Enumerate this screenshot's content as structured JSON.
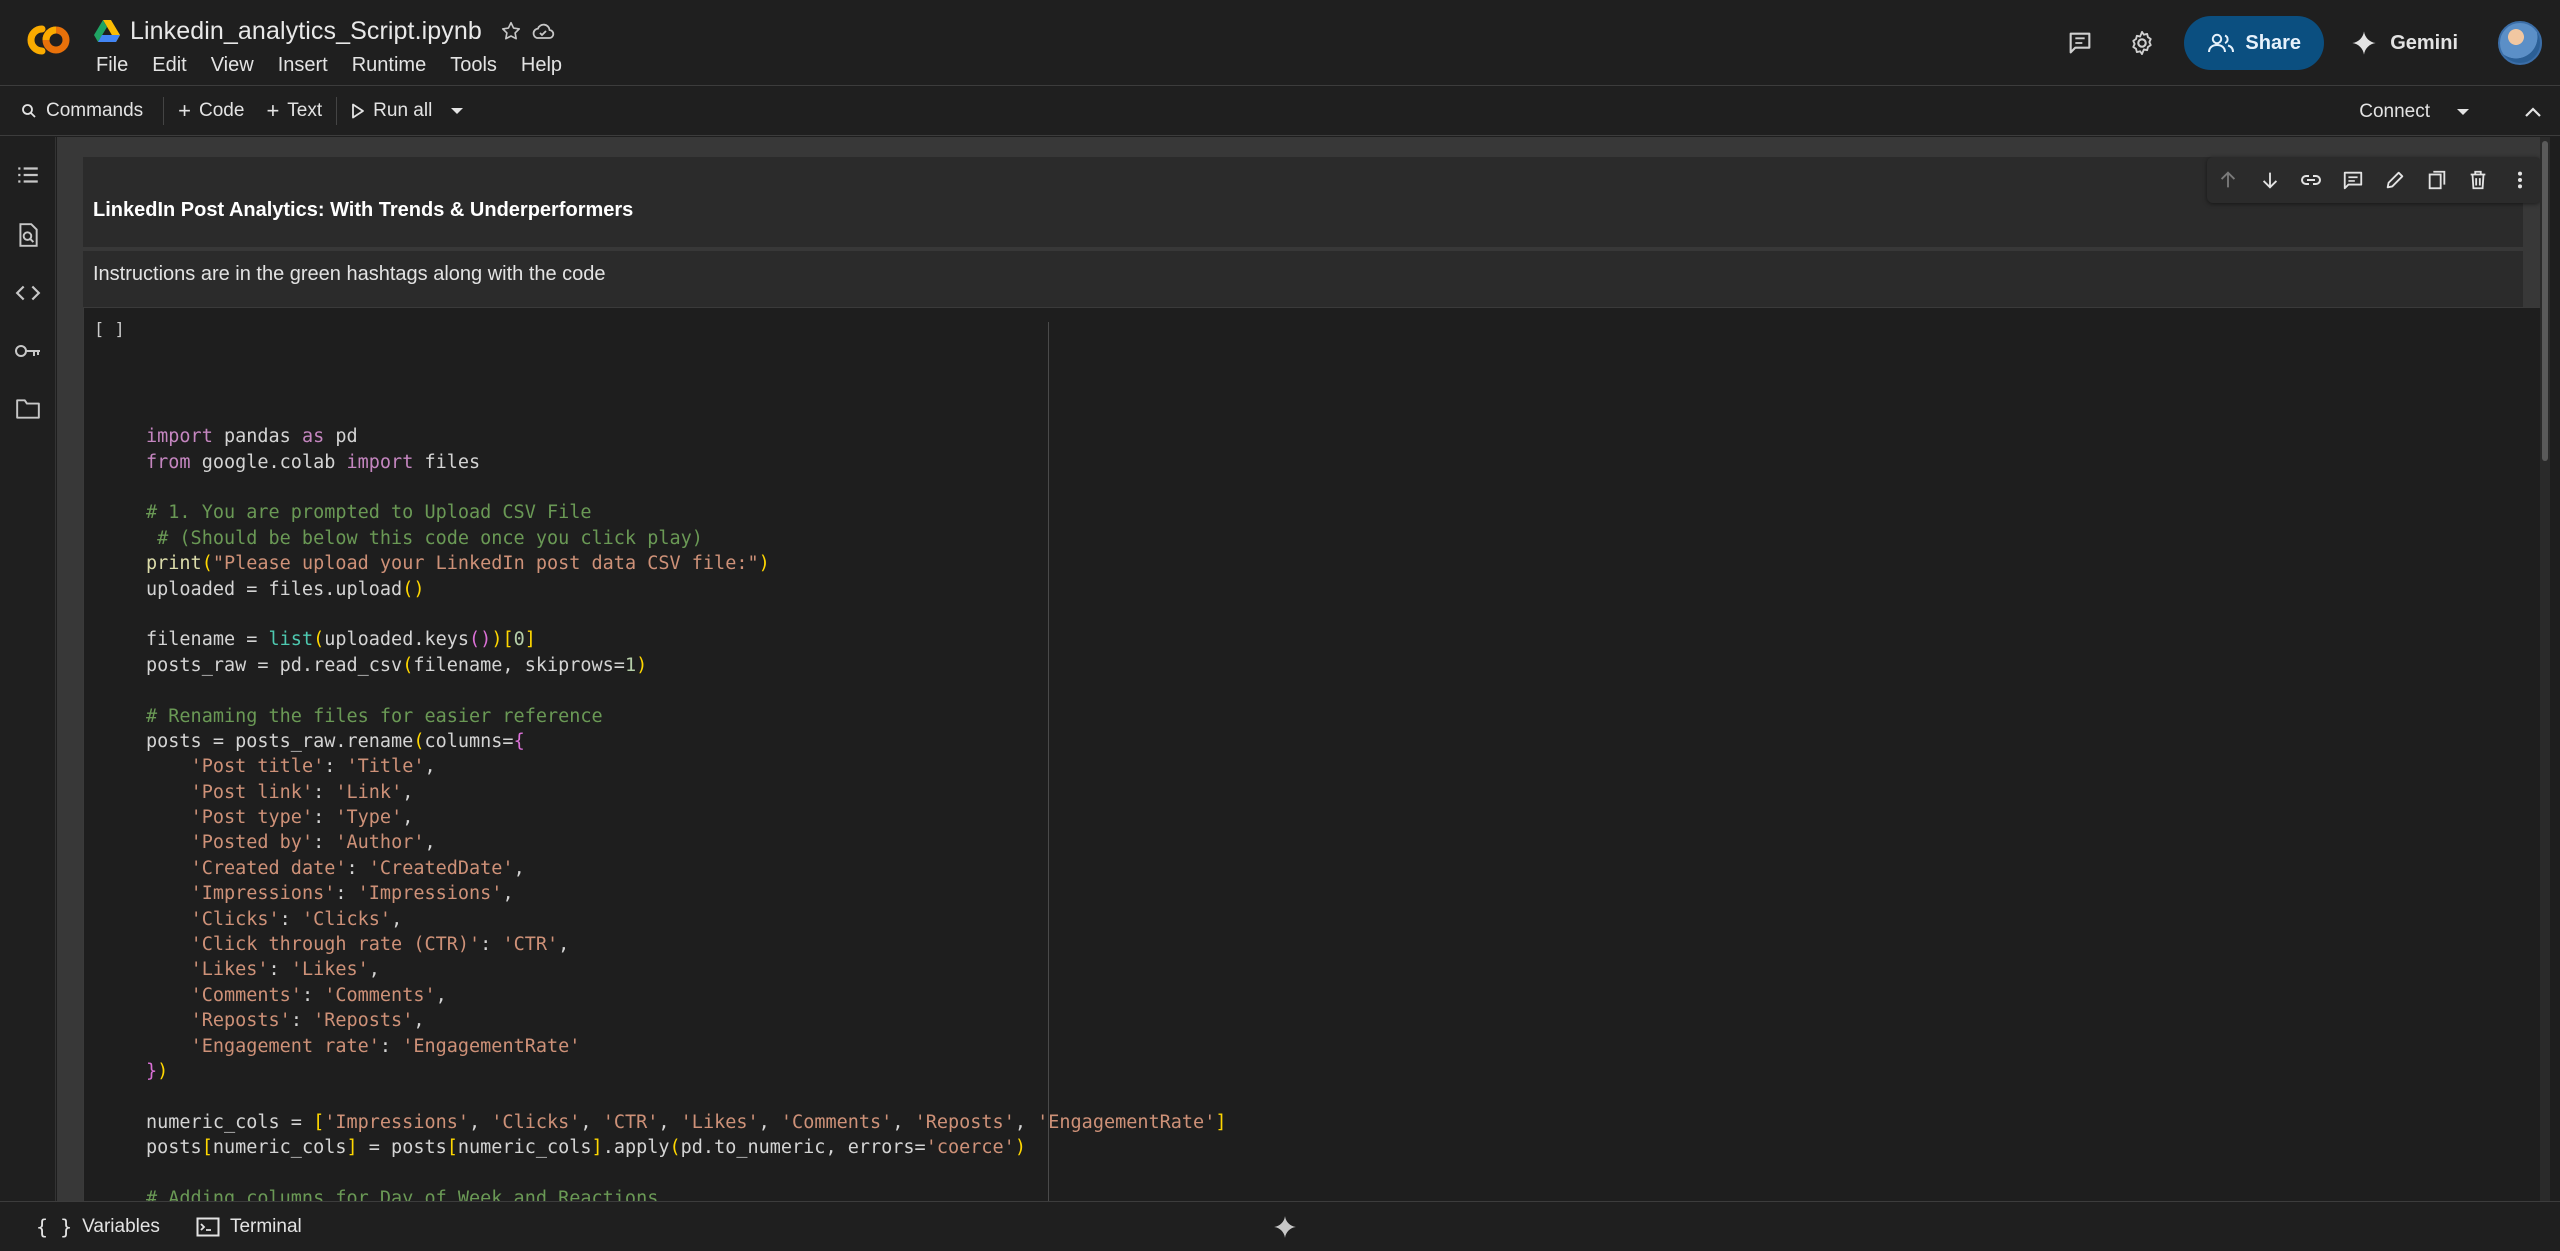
{
  "header": {
    "notebook_title": "Linkedin_analytics_Script.ipynb",
    "menu": [
      "File",
      "Edit",
      "View",
      "Insert",
      "Runtime",
      "Tools",
      "Help"
    ],
    "share_label": "Share",
    "gemini_label": "Gemini",
    "brand_color": "#f9ab00",
    "share_color": "#0b4f80"
  },
  "toolbar": {
    "commands_label": "Commands",
    "code_label": "Code",
    "text_label": "Text",
    "run_all_label": "Run all",
    "connect_label": "Connect"
  },
  "sidebar": {
    "icons": [
      "table-of-contents-icon",
      "find-icon",
      "code-snippets-icon",
      "secrets-key-icon",
      "files-folder-icon"
    ]
  },
  "cells": {
    "heading": "LinkedIn Post Analytics: With Trends & Underperformers",
    "instructions": "Instructions are in the green hashtags along with the code",
    "run_indicator": "[ ]"
  },
  "bottom": {
    "variables_label": "Variables",
    "terminal_label": "Terminal"
  }
}
